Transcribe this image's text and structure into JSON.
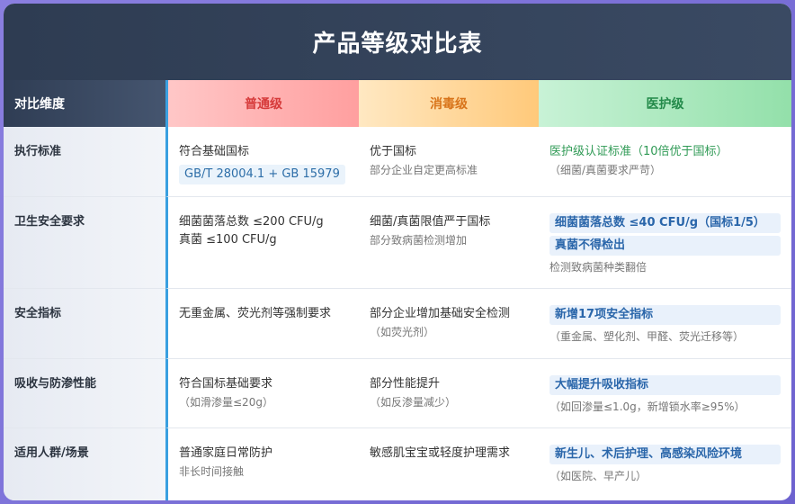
{
  "title": "产品等级对比表",
  "headers": {
    "dimension": "对比维度",
    "ordinary": "普通级",
    "disinfect": "消毒级",
    "medical": "医护级"
  },
  "rows": [
    {
      "dim": "执行标准",
      "ord_1": "符合基础国标",
      "ord_chip": "GB/T 28004.1 + GB 15979",
      "dis_1": "优于国标",
      "dis_2": "部分企业自定更高标准",
      "med_1": "医护级认证标准（10倍优于国标）",
      "med_2": "（细菌/真菌要求严苛）"
    },
    {
      "dim": "卫生安全要求",
      "ord_1": "细菌菌落总数 ≤200 CFU/g",
      "ord_2": "真菌 ≤100 CFU/g",
      "dis_1": "细菌/真菌限值严于国标",
      "dis_2": "部分致病菌检测增加",
      "med_hl1": "细菌菌落总数 ≤40 CFU/g（国标1/5）",
      "med_hl2": "真菌不得检出",
      "med_2": "检测致病菌种类翻倍"
    },
    {
      "dim": "安全指标",
      "ord_1": "无重金属、荧光剂等强制要求",
      "dis_1": "部分企业增加基础安全检测",
      "dis_2": "（如荧光剂）",
      "med_hl1": "新增17项安全指标",
      "med_2": "（重金属、塑化剂、甲醛、荧光迁移等）"
    },
    {
      "dim": "吸收与防渗性能",
      "ord_1": "符合国标基础要求",
      "ord_2": "（如滑渗量≤20g）",
      "dis_1": "部分性能提升",
      "dis_2": "（如反渗量减少）",
      "med_hl1": "大幅提升吸收指标",
      "med_2": "（如回渗量≤1.0g，新增锁水率≥95%）"
    },
    {
      "dim": "适用人群/场景",
      "ord_1": "普通家庭日常防护",
      "ord_2": "非长时间接触",
      "dis_1": "敏感肌宝宝或轻度护理需求",
      "med_hl1": "新生儿、术后护理、高感染风险环境",
      "med_2": "（如医院、早产儿）"
    }
  ]
}
